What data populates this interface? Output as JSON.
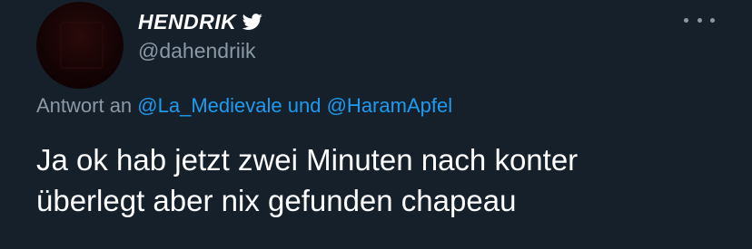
{
  "author": {
    "display_name": "HENDRIK",
    "handle": "@dahendriik",
    "verified_icon": "twitter-bird-icon"
  },
  "menu": {
    "icon": "more-horizontal-icon"
  },
  "reply": {
    "prefix": "Antwort an",
    "mention_1": "@La_Medievale",
    "connector": "und",
    "mention_2": "@HaramApfel"
  },
  "tweet": {
    "line_1": "Ja ok hab jetzt zwei Minuten nach konter",
    "line_2": "überlegt aber nix gefunden chapeau"
  },
  "colors": {
    "background": "#15202b",
    "primary_text": "#ffffff",
    "secondary_text": "#8b98a5",
    "accent": "#1d9bf0"
  }
}
